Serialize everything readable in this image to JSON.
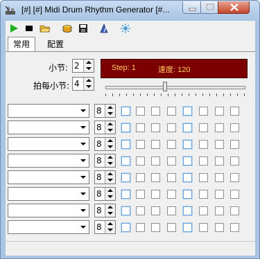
{
  "window": {
    "title": "[#] [#] Midi Drum Rhythm Generator [#..."
  },
  "tabs": [
    {
      "label": "常用"
    },
    {
      "label": "配置"
    }
  ],
  "settings": {
    "bars_label": "小节:",
    "bars_value": "2",
    "beats_label": "拍每小节:",
    "beats_value": "4"
  },
  "display": {
    "step_text": "Step: 1",
    "tempo_text": "速度: 120"
  },
  "tempo_slider": {
    "fraction": 0.43
  },
  "colors": {
    "display_bg": "#7d0000",
    "display_fg": "#ffcc66"
  },
  "toolbar": [
    "play-icon",
    "stop-icon",
    "open-folder-icon",
    "drum-icon",
    "save-icon",
    "metronome-icon",
    "settings-icon"
  ],
  "rows": [
    {
      "instrument": "",
      "steps": "8",
      "checks": [
        false,
        false,
        false,
        false,
        false,
        false,
        false,
        false
      ]
    },
    {
      "instrument": "",
      "steps": "8",
      "checks": [
        false,
        false,
        false,
        false,
        false,
        false,
        false,
        false
      ]
    },
    {
      "instrument": "",
      "steps": "8",
      "checks": [
        false,
        false,
        false,
        false,
        false,
        false,
        false,
        false
      ]
    },
    {
      "instrument": "",
      "steps": "8",
      "checks": [
        false,
        false,
        false,
        false,
        false,
        false,
        false,
        false
      ]
    },
    {
      "instrument": "",
      "steps": "8",
      "checks": [
        false,
        false,
        false,
        false,
        false,
        false,
        false,
        false
      ]
    },
    {
      "instrument": "",
      "steps": "8",
      "checks": [
        false,
        false,
        false,
        false,
        false,
        false,
        false,
        false
      ]
    },
    {
      "instrument": "",
      "steps": "8",
      "checks": [
        false,
        false,
        false,
        false,
        false,
        false,
        false,
        false
      ]
    },
    {
      "instrument": "",
      "steps": "8",
      "checks": [
        false,
        false,
        false,
        false,
        false,
        false,
        false,
        false
      ]
    }
  ]
}
